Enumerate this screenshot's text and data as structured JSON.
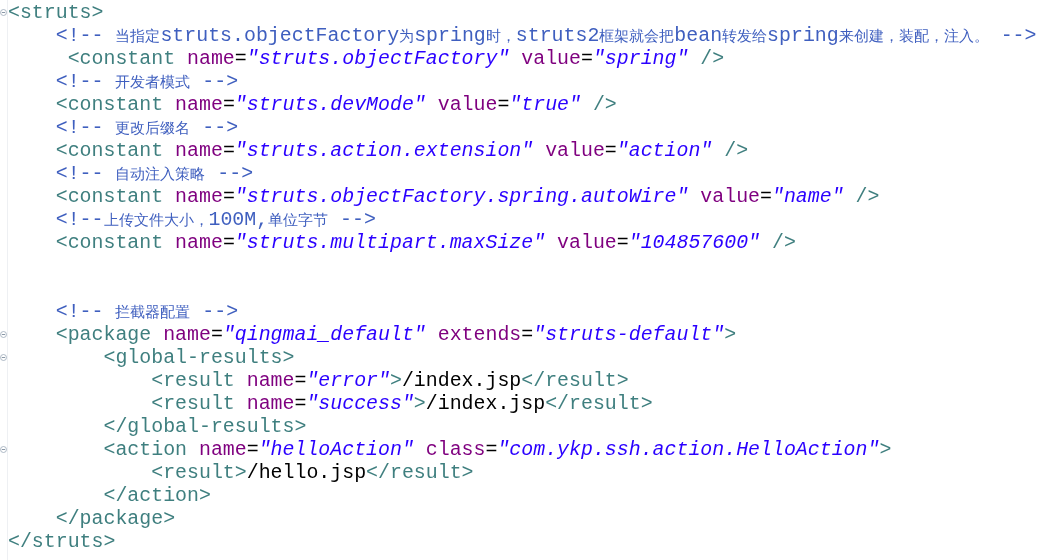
{
  "editor": {
    "lines": [
      {
        "kind": "code",
        "fold": true,
        "tokens": [
          {
            "kind": "tag",
            "text": "<struts>"
          }
        ]
      },
      {
        "kind": "code",
        "fold": false,
        "tokens": [
          {
            "kind": "comment",
            "text": "    <!-- 当指定struts.objectFactory为spring时，struts2框架就会把bean转发给spring来创建，装配，注入。 -->"
          }
        ]
      },
      {
        "kind": "code",
        "fold": false,
        "tokens": [
          {
            "kind": "tag",
            "text": "     <constant"
          },
          {
            "kind": "attr",
            "text": " name"
          },
          {
            "kind": "eq",
            "text": "="
          },
          {
            "kind": "value",
            "text": "\"struts.objectFactory\""
          },
          {
            "kind": "attr",
            "text": " value"
          },
          {
            "kind": "eq",
            "text": "="
          },
          {
            "kind": "value",
            "text": "\"spring\""
          },
          {
            "kind": "tag",
            "text": " />"
          }
        ]
      },
      {
        "kind": "code",
        "fold": false,
        "tokens": [
          {
            "kind": "comment",
            "text": "    <!-- 开发者模式 -->"
          }
        ]
      },
      {
        "kind": "code",
        "fold": false,
        "tokens": [
          {
            "kind": "tag",
            "text": "    <constant"
          },
          {
            "kind": "attr",
            "text": " name"
          },
          {
            "kind": "eq",
            "text": "="
          },
          {
            "kind": "value",
            "text": "\"struts.devMode\""
          },
          {
            "kind": "attr",
            "text": " value"
          },
          {
            "kind": "eq",
            "text": "="
          },
          {
            "kind": "value",
            "text": "\"true\""
          },
          {
            "kind": "tag",
            "text": " />"
          }
        ]
      },
      {
        "kind": "code",
        "fold": false,
        "tokens": [
          {
            "kind": "comment",
            "text": "    <!-- 更改后缀名 -->"
          }
        ]
      },
      {
        "kind": "code",
        "fold": false,
        "tokens": [
          {
            "kind": "tag",
            "text": "    <constant"
          },
          {
            "kind": "attr",
            "text": " name"
          },
          {
            "kind": "eq",
            "text": "="
          },
          {
            "kind": "value",
            "text": "\"struts.action.extension\""
          },
          {
            "kind": "attr",
            "text": " value"
          },
          {
            "kind": "eq",
            "text": "="
          },
          {
            "kind": "value",
            "text": "\"action\""
          },
          {
            "kind": "tag",
            "text": " />"
          }
        ]
      },
      {
        "kind": "code",
        "fold": false,
        "tokens": [
          {
            "kind": "comment",
            "text": "    <!-- 自动注入策略 -->"
          }
        ]
      },
      {
        "kind": "code",
        "fold": false,
        "tokens": [
          {
            "kind": "tag",
            "text": "    <constant"
          },
          {
            "kind": "attr",
            "text": " name"
          },
          {
            "kind": "eq",
            "text": "="
          },
          {
            "kind": "value",
            "text": "\"struts.objectFactory.spring.autoWire\""
          },
          {
            "kind": "attr",
            "text": " value"
          },
          {
            "kind": "eq",
            "text": "="
          },
          {
            "kind": "value",
            "text": "\"name\""
          },
          {
            "kind": "tag",
            "text": " />"
          }
        ]
      },
      {
        "kind": "code",
        "fold": false,
        "tokens": [
          {
            "kind": "comment",
            "text": "    <!--上传文件大小，100M,单位字节 -->"
          }
        ]
      },
      {
        "kind": "code",
        "fold": false,
        "tokens": [
          {
            "kind": "tag",
            "text": "    <constant"
          },
          {
            "kind": "attr",
            "text": " name"
          },
          {
            "kind": "eq",
            "text": "="
          },
          {
            "kind": "value",
            "text": "\"struts.multipart.maxSize\""
          },
          {
            "kind": "attr",
            "text": " value"
          },
          {
            "kind": "eq",
            "text": "="
          },
          {
            "kind": "value",
            "text": "\"104857600\""
          },
          {
            "kind": "tag",
            "text": " />"
          }
        ]
      },
      {
        "kind": "blank",
        "fold": false
      },
      {
        "kind": "blank",
        "fold": false
      },
      {
        "kind": "code",
        "fold": false,
        "tokens": [
          {
            "kind": "comment",
            "text": "    <!-- 拦截器配置 -->"
          }
        ]
      },
      {
        "kind": "code",
        "fold": true,
        "tokens": [
          {
            "kind": "tag",
            "text": "    <package"
          },
          {
            "kind": "attr",
            "text": " name"
          },
          {
            "kind": "eq",
            "text": "="
          },
          {
            "kind": "value",
            "text": "\"qingmai_default\""
          },
          {
            "kind": "attr",
            "text": " extends"
          },
          {
            "kind": "eq",
            "text": "="
          },
          {
            "kind": "value",
            "text": "\"struts-default\""
          },
          {
            "kind": "tag",
            "text": ">"
          }
        ]
      },
      {
        "kind": "code",
        "fold": true,
        "tokens": [
          {
            "kind": "tag",
            "text": "        <global-results>"
          }
        ]
      },
      {
        "kind": "code",
        "fold": false,
        "tokens": [
          {
            "kind": "tag",
            "text": "            <result"
          },
          {
            "kind": "attr",
            "text": " name"
          },
          {
            "kind": "eq",
            "text": "="
          },
          {
            "kind": "value",
            "text": "\"error\""
          },
          {
            "kind": "tag",
            "text": ">"
          },
          {
            "kind": "text",
            "text": "/index.jsp"
          },
          {
            "kind": "tag",
            "text": "</result>"
          }
        ]
      },
      {
        "kind": "code",
        "fold": false,
        "tokens": [
          {
            "kind": "tag",
            "text": "            <result"
          },
          {
            "kind": "attr",
            "text": " name"
          },
          {
            "kind": "eq",
            "text": "="
          },
          {
            "kind": "value",
            "text": "\"success\""
          },
          {
            "kind": "tag",
            "text": ">"
          },
          {
            "kind": "text",
            "text": "/index.jsp"
          },
          {
            "kind": "tag",
            "text": "</result>"
          }
        ]
      },
      {
        "kind": "code",
        "fold": false,
        "tokens": [
          {
            "kind": "tag",
            "text": "        </global-results>"
          }
        ]
      },
      {
        "kind": "code",
        "fold": true,
        "tokens": [
          {
            "kind": "tag",
            "text": "        <action"
          },
          {
            "kind": "attr",
            "text": " name"
          },
          {
            "kind": "eq",
            "text": "="
          },
          {
            "kind": "value",
            "text": "\"helloAction\""
          },
          {
            "kind": "attr",
            "text": " class"
          },
          {
            "kind": "eq",
            "text": "="
          },
          {
            "kind": "value",
            "text": "\"com.ykp.ssh.action.HelloAction\""
          },
          {
            "kind": "tag",
            "text": ">"
          }
        ]
      },
      {
        "kind": "code",
        "fold": false,
        "tokens": [
          {
            "kind": "tag",
            "text": "            <result>"
          },
          {
            "kind": "text",
            "text": "/hello.jsp"
          },
          {
            "kind": "tag",
            "text": "</result>"
          }
        ]
      },
      {
        "kind": "code",
        "fold": false,
        "tokens": [
          {
            "kind": "tag",
            "text": "        </action>"
          }
        ]
      },
      {
        "kind": "code",
        "fold": false,
        "tokens": [
          {
            "kind": "tag",
            "text": "    </package>"
          }
        ]
      },
      {
        "kind": "code",
        "fold": false,
        "tokens": [
          {
            "kind": "tag",
            "text": "</struts>"
          }
        ]
      }
    ]
  }
}
